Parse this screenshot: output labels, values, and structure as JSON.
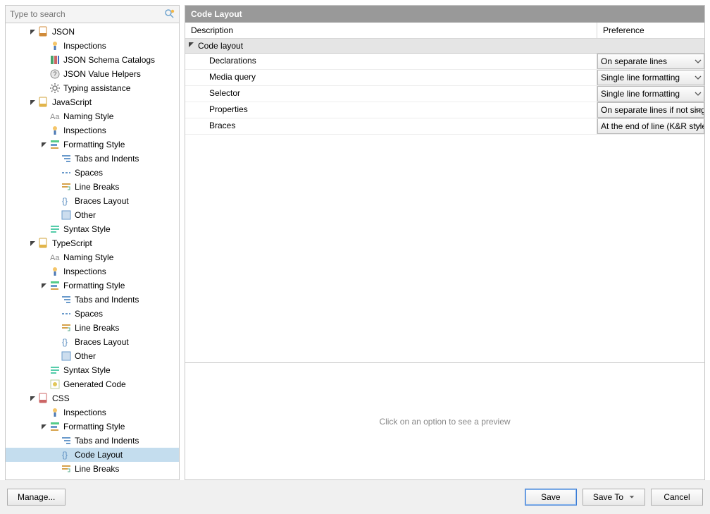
{
  "search": {
    "placeholder": "Type to search"
  },
  "title": "Code Layout",
  "headers": {
    "description": "Description",
    "preference": "Preference"
  },
  "group": "Code layout",
  "rows": [
    {
      "label": "Declarations",
      "value": "On separate lines"
    },
    {
      "label": "Media query",
      "value": "Single line formatting"
    },
    {
      "label": "Selector",
      "value": "Single line formatting"
    },
    {
      "label": "Properties",
      "value": "On separate lines if not single"
    },
    {
      "label": "Braces",
      "value": "At the end of line (K&R style)"
    }
  ],
  "preview_hint": "Click on an option to see a preview",
  "buttons": {
    "manage": "Manage...",
    "save": "Save",
    "save_to": "Save To",
    "cancel": "Cancel"
  },
  "tree": {
    "json": {
      "label": "JSON",
      "inspections": "Inspections",
      "catalogs": "JSON Schema Catalogs",
      "helpers": "JSON Value Helpers",
      "typing": "Typing assistance"
    },
    "js": {
      "label": "JavaScript",
      "naming": "Naming Style",
      "inspections": "Inspections",
      "fmt": {
        "label": "Formatting Style",
        "tabs": "Tabs and Indents",
        "spaces": "Spaces",
        "breaks": "Line Breaks",
        "braces": "Braces Layout",
        "other": "Other"
      },
      "syntax": "Syntax Style"
    },
    "ts": {
      "label": "TypeScript",
      "naming": "Naming Style",
      "inspections": "Inspections",
      "fmt": {
        "label": "Formatting Style",
        "tabs": "Tabs and Indents",
        "spaces": "Spaces",
        "breaks": "Line Breaks",
        "braces": "Braces Layout",
        "other": "Other"
      },
      "syntax": "Syntax Style",
      "gen": "Generated Code"
    },
    "css": {
      "label": "CSS",
      "inspections": "Inspections",
      "fmt": {
        "label": "Formatting Style",
        "tabs": "Tabs and Indents",
        "layout": "Code Layout",
        "breaks": "Line Breaks"
      }
    }
  }
}
